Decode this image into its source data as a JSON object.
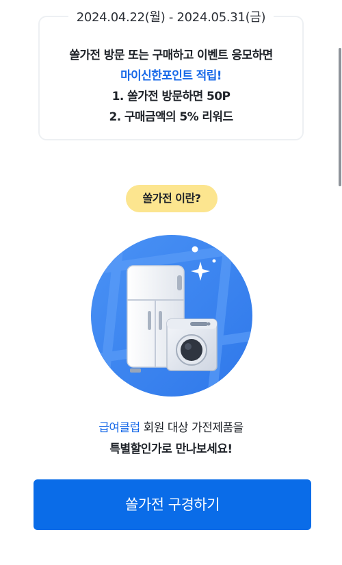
{
  "event": {
    "period": "2024.04.22(월) - 2024.05.31(금)",
    "line1": "쏠가전 방문 또는 구매하고 이벤트 응모하면",
    "line2_highlight": "마이신한포인트 적립!",
    "line3": "1. 쏠가전 방문하면 50P",
    "line4": "2. 구매금액의 5% 리워드"
  },
  "badge": {
    "label": "쏠가전 이란?"
  },
  "description": {
    "highlight": "급여클럽",
    "line1_rest": " 회원 대상 가전제품을",
    "line2": "특별할인가로 만나보세요!"
  },
  "cta": {
    "label": "쏠가전 구경하기"
  },
  "colors": {
    "accent": "#1769e8",
    "button": "#0a6ce8",
    "badge": "#fce58f",
    "circle": "#3d86f2"
  },
  "icons": {
    "illustration": "refrigerator-and-washing-machine-icon"
  }
}
